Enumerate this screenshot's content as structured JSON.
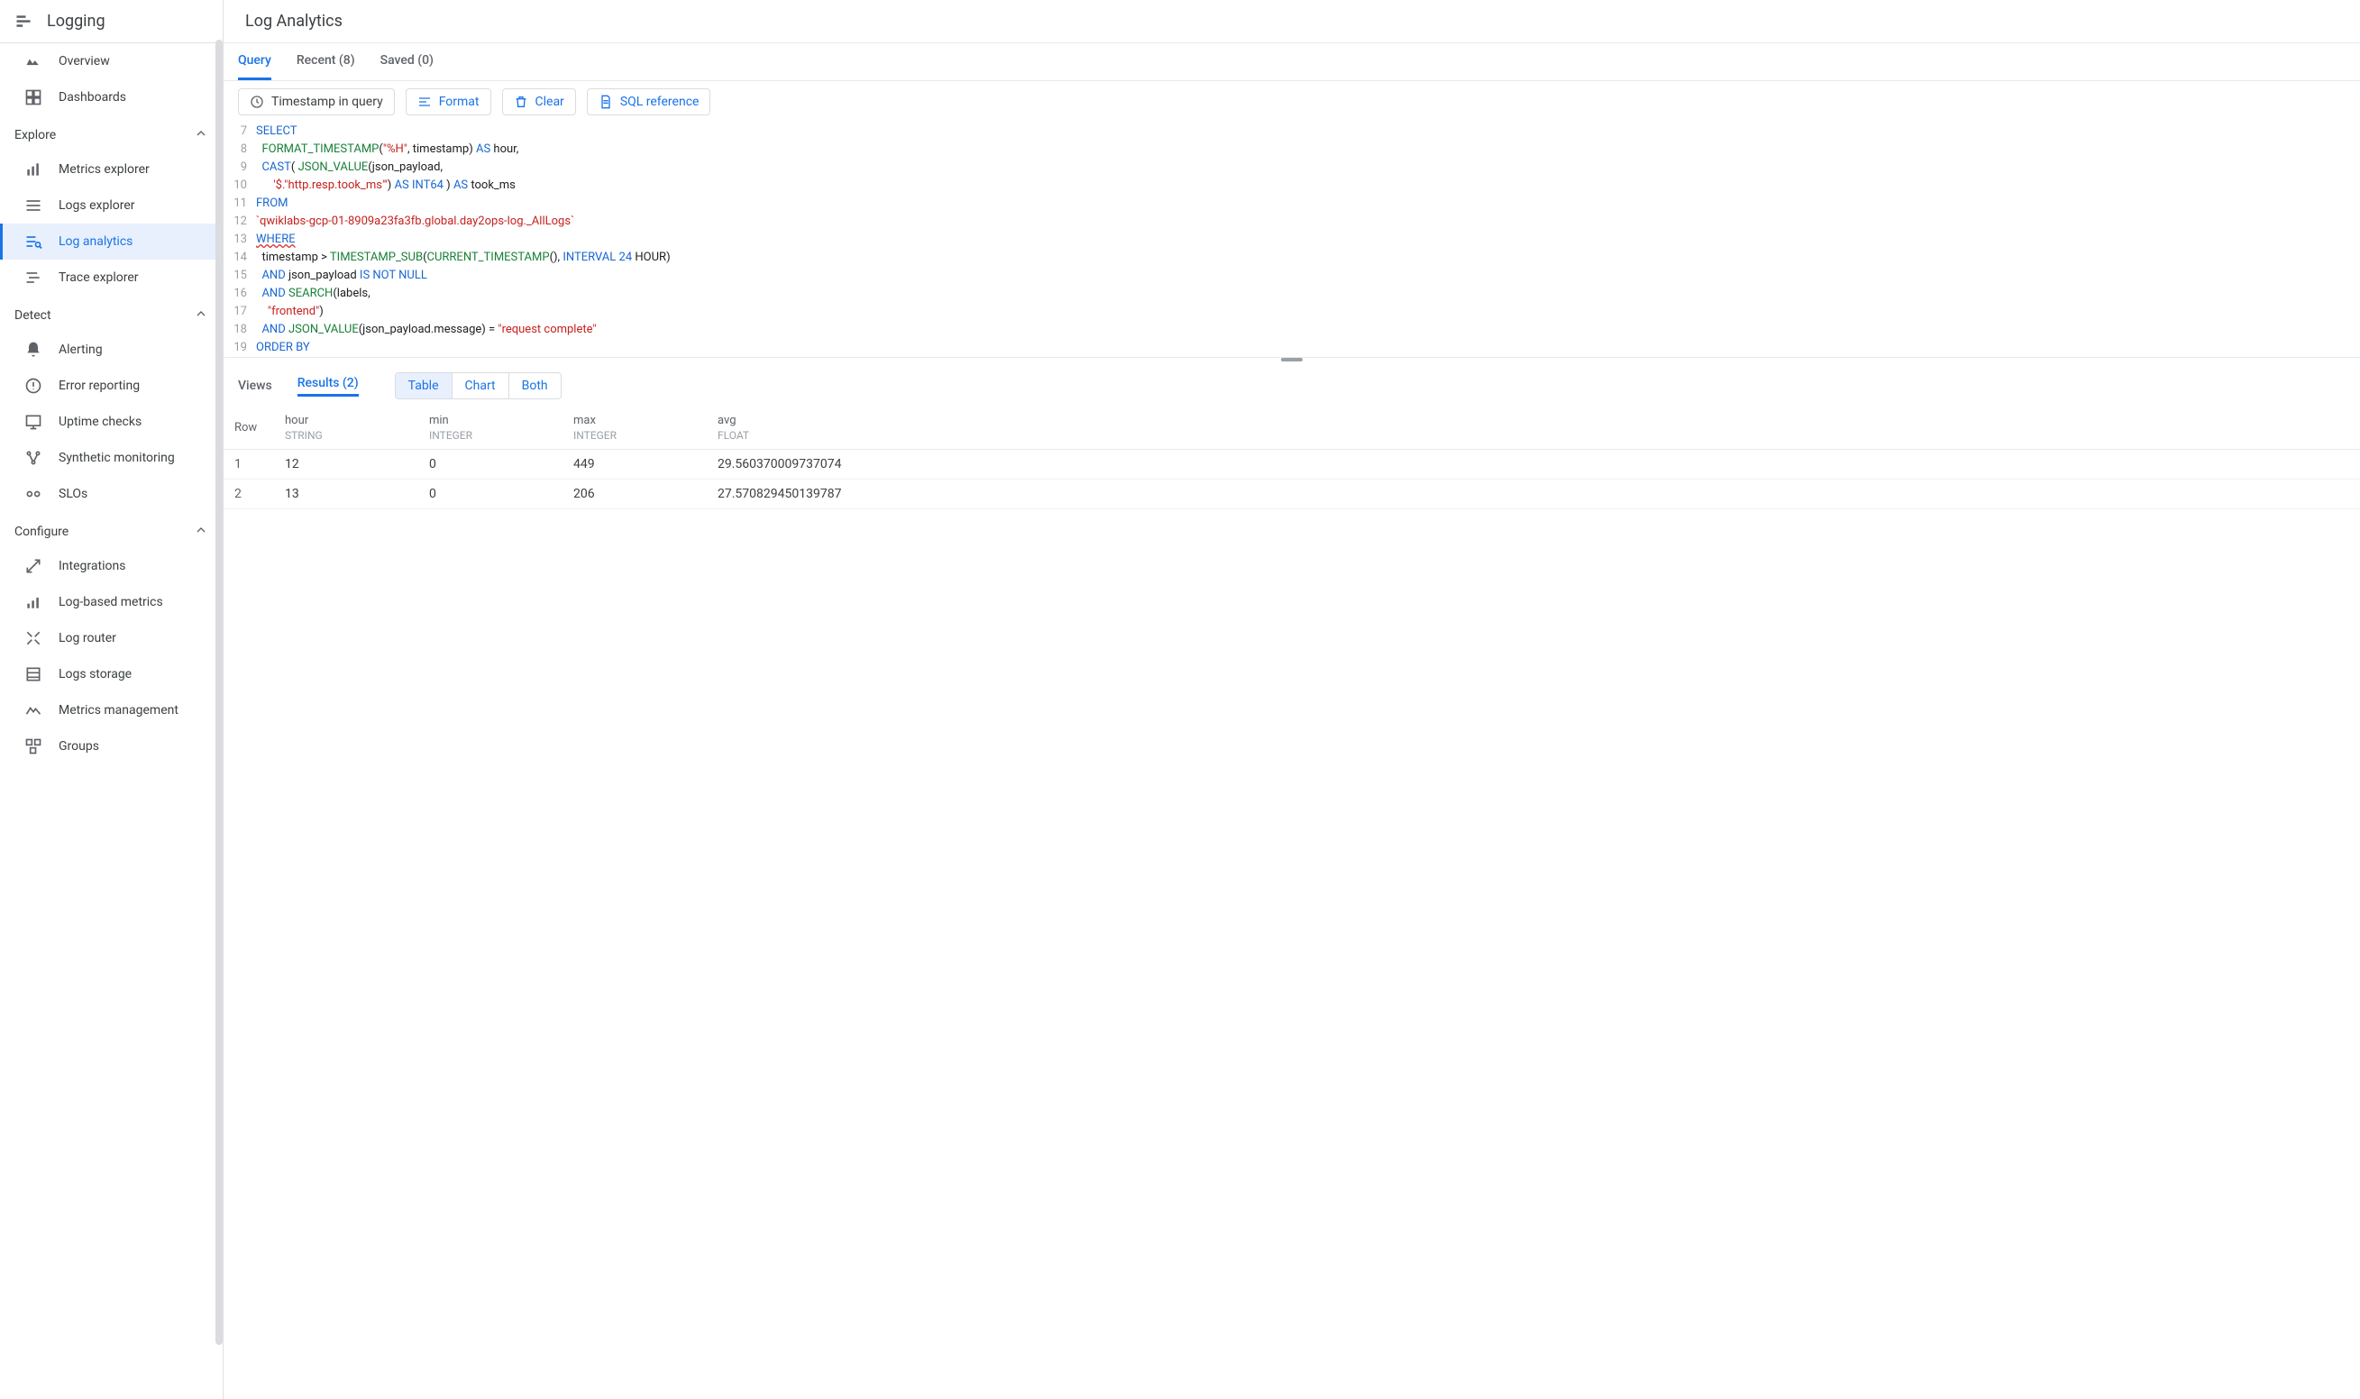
{
  "product": {
    "title": "Logging"
  },
  "sidebar": {
    "top": [
      {
        "label": "Overview"
      },
      {
        "label": "Dashboards"
      }
    ],
    "sections": [
      {
        "title": "Explore",
        "items": [
          {
            "label": "Metrics explorer"
          },
          {
            "label": "Logs explorer"
          },
          {
            "label": "Log analytics",
            "active": true
          },
          {
            "label": "Trace explorer"
          }
        ]
      },
      {
        "title": "Detect",
        "items": [
          {
            "label": "Alerting"
          },
          {
            "label": "Error reporting"
          },
          {
            "label": "Uptime checks"
          },
          {
            "label": "Synthetic monitoring"
          },
          {
            "label": "SLOs"
          }
        ]
      },
      {
        "title": "Configure",
        "items": [
          {
            "label": "Integrations"
          },
          {
            "label": "Log-based metrics"
          },
          {
            "label": "Log router"
          },
          {
            "label": "Logs storage"
          },
          {
            "label": "Metrics management"
          },
          {
            "label": "Groups"
          }
        ]
      }
    ]
  },
  "page": {
    "title": "Log Analytics"
  },
  "tabs": {
    "query": "Query",
    "recent": "Recent (8)",
    "saved": "Saved (0)"
  },
  "toolbar": {
    "timestamp": "Timestamp in query",
    "format": "Format",
    "clear": "Clear",
    "sqlref": "SQL reference"
  },
  "editor": {
    "lines": [
      {
        "n": 7,
        "html": "<span class='kw'>SELECT</span>"
      },
      {
        "n": 8,
        "html": "  <span class='fn'>FORMAT_TIMESTAMP</span>(<span class='str'>\"%H\"</span>, <span class='id'>timestamp</span>) <span class='kw'>AS</span> <span class='id'>hour</span>,"
      },
      {
        "n": 9,
        "html": "  <span class='kw'>CAST</span>( <span class='fn'>JSON_VALUE</span>(<span class='id'>json_payload</span>,"
      },
      {
        "n": 10,
        "html": "      <span class='str'>'$.\"http.resp.took_ms\"'</span>) <span class='kw'>AS</span> <span class='kw'>INT64</span> ) <span class='kw'>AS</span> <span class='id'>took_ms</span>"
      },
      {
        "n": 11,
        "html": "<span class='kw'>FROM</span>"
      },
      {
        "n": 12,
        "html": "<span class='tbl'>`qwiklabs-gcp-01-8909a23fa3fb.global.day2ops-log._AllLogs`</span>"
      },
      {
        "n": 13,
        "html": "<span class='kw'>WHERE</span>",
        "hl": true
      },
      {
        "n": 14,
        "html": "  <span class='id'>timestamp</span> &gt; <span class='fn'>TIMESTAMP_SUB</span>(<span class='fn'>CURRENT_TIMESTAMP</span>(), <span class='kw'>INTERVAL</span> <span class='num'>24</span> <span class='id'>HOUR</span>)"
      },
      {
        "n": 15,
        "html": "  <span class='kw'>AND</span> <span class='id'>json_payload</span> <span class='kw'>IS NOT NULL</span>"
      },
      {
        "n": 16,
        "html": "  <span class='kw'>AND</span> <span class='fn'>SEARCH</span>(<span class='id'>labels</span>,"
      },
      {
        "n": 17,
        "html": "    <span class='str'>\"frontend\"</span>)"
      },
      {
        "n": 18,
        "html": "  <span class='kw'>AND</span> <span class='fn'>JSON_VALUE</span>(<span class='id'>json_payload</span>.<span class='id'>message</span>) = <span class='str'>\"request complete\"</span>"
      },
      {
        "n": 19,
        "html": "<span class='kw'>ORDER BY</span>"
      }
    ]
  },
  "results": {
    "views_label": "Views",
    "results_label": "Results (2)",
    "seg": {
      "table": "Table",
      "chart": "Chart",
      "both": "Both"
    },
    "columns": [
      {
        "name": "Row",
        "type": ""
      },
      {
        "name": "hour",
        "type": "STRING"
      },
      {
        "name": "min",
        "type": "INTEGER"
      },
      {
        "name": "max",
        "type": "INTEGER"
      },
      {
        "name": "avg",
        "type": "FLOAT"
      }
    ],
    "rows": [
      {
        "row": "1",
        "hour": "12",
        "min": "0",
        "max": "449",
        "avg": "29.560370009737074"
      },
      {
        "row": "2",
        "hour": "13",
        "min": "0",
        "max": "206",
        "avg": "27.570829450139787"
      }
    ]
  }
}
